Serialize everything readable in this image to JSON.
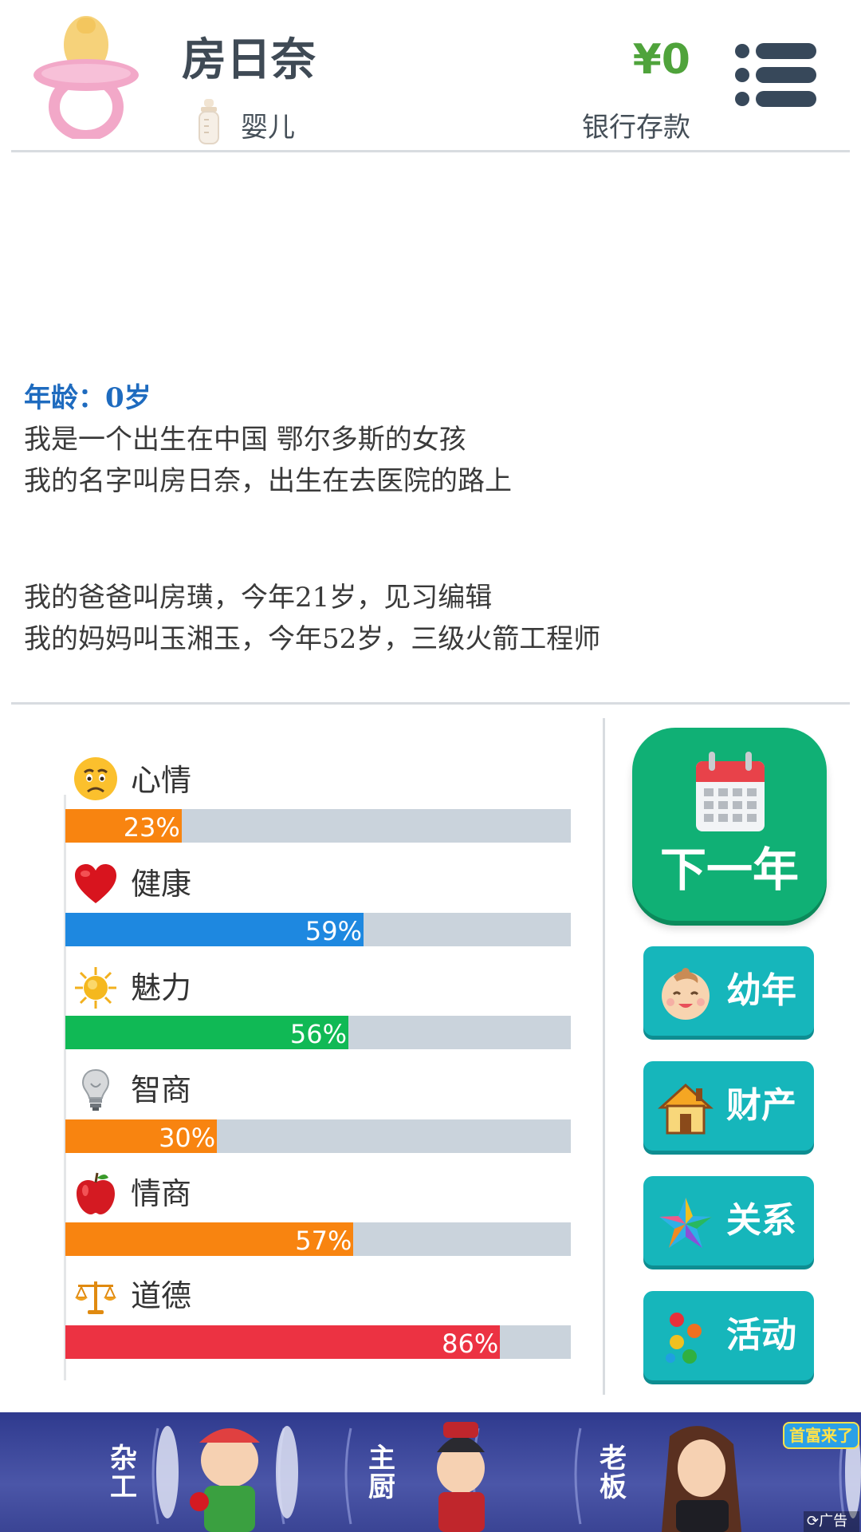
{
  "header": {
    "name": "房日奈",
    "stage_icon": "baby-bottle-icon",
    "stage": "婴儿",
    "money": "¥0",
    "bank_label": "银行存款",
    "avatar_icon": "pacifier-icon",
    "menu_icon": "menu-icon"
  },
  "story": {
    "age": "年龄：0岁",
    "lines": [
      "我是一个出生在中国 鄂尔多斯的女孩",
      "我的名字叫房日奈，出生在去医院的路上",
      "我的爸爸叫房璜，今年21岁，见习编辑",
      "我的妈妈叫玉湘玉，今年52岁，三级火箭工程师"
    ]
  },
  "stats": [
    {
      "label": "心情",
      "icon": "sad-face-icon",
      "value": 23,
      "pct": "23%",
      "color": "#f88410"
    },
    {
      "label": "健康",
      "icon": "heart-icon",
      "value": 59,
      "pct": "59%",
      "color": "#1e88e0"
    },
    {
      "label": "魅力",
      "icon": "sun-icon",
      "value": 56,
      "pct": "56%",
      "color": "#10b955"
    },
    {
      "label": "智商",
      "icon": "lightbulb-icon",
      "value": 30,
      "pct": "30%",
      "color": "#f88410"
    },
    {
      "label": "情商",
      "icon": "apple-icon",
      "value": 57,
      "pct": "57%",
      "color": "#f88410"
    },
    {
      "label": "道德",
      "icon": "scales-icon",
      "value": 86,
      "pct": "86%",
      "color": "#ec3242"
    }
  ],
  "actions": {
    "next_year": {
      "label": "下一年",
      "icon": "calendar-icon"
    },
    "buttons": [
      {
        "label": "幼年",
        "icon": "baby-face-icon"
      },
      {
        "label": "财产",
        "icon": "house-icon"
      },
      {
        "label": "关系",
        "icon": "star-icon"
      },
      {
        "label": "活动",
        "icon": "activity-icon"
      }
    ]
  },
  "ad": {
    "jobs": [
      "杂工",
      "主厨",
      "老板"
    ],
    "badge": "首富来了",
    "ad_label": "广告",
    "ad_icon": "refresh-icon"
  }
}
